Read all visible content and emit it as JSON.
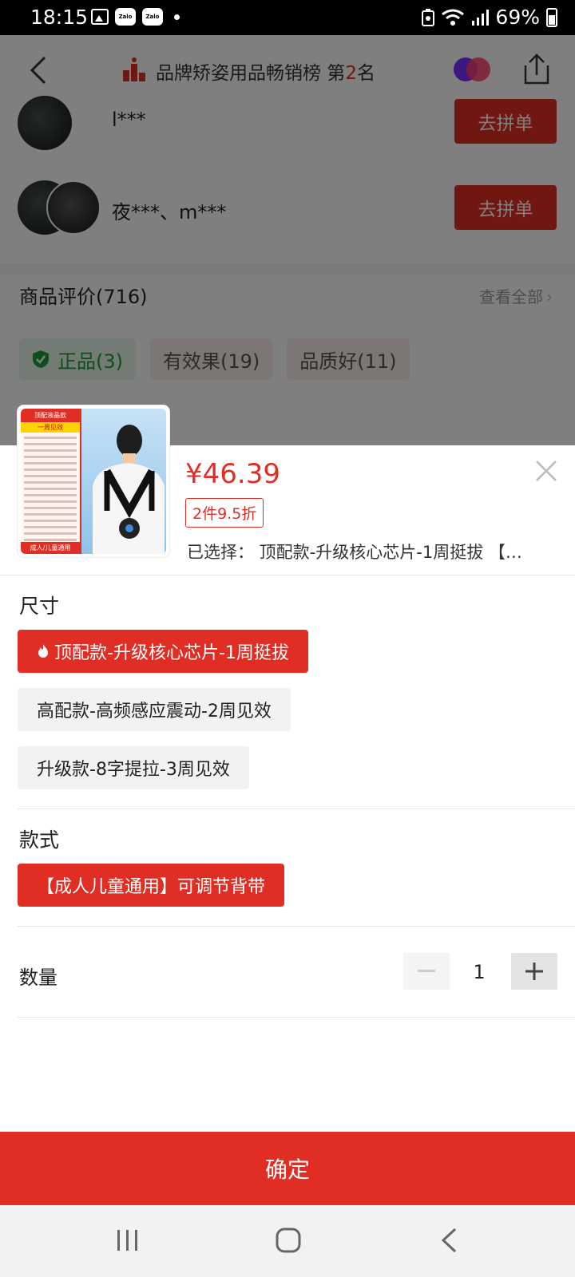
{
  "status_bar": {
    "time": "18:15",
    "notification_icons": [
      "image-icon",
      "zalo-icon",
      "zalo-icon"
    ],
    "zalo_label": "Zalo",
    "battery": "69%"
  },
  "header": {
    "title": "品牌矫姿用品畅销榜 第",
    "rank": "2",
    "rank_suffix": "名"
  },
  "group_buy": [
    {
      "name": "l***",
      "button": "去拼单"
    },
    {
      "name": "夜***、m***",
      "button": "去拼单"
    }
  ],
  "reviews": {
    "title": "商品评价(716)",
    "view_all": "查看全部",
    "tags": [
      "正品(3)",
      "有效果(19)",
      "品质好(11)"
    ]
  },
  "product_image": {
    "head": "顶配液晶款",
    "sub": "一周见效",
    "foot": "成人/儿童通用"
  },
  "sheet": {
    "price": "¥46.39",
    "discount": "2件9.5折",
    "selected": "已选择： 顶配款-升级核心芯片-1周挺拔 【…"
  },
  "size_section": {
    "label": "尺寸",
    "options": [
      {
        "label": "顶配款-升级核心芯片-1周挺拔",
        "selected": true,
        "hot": true
      },
      {
        "label": "高配款-高频感应震动-2周见效",
        "selected": false
      },
      {
        "label": "升级款-8字提拉-3周见效",
        "selected": false
      }
    ]
  },
  "style_section": {
    "label": "款式",
    "options": [
      {
        "label": "【成人儿童通用】可调节背带",
        "selected": true
      }
    ]
  },
  "quantity": {
    "label": "数量",
    "value": "1"
  },
  "confirm_button": "确定",
  "colors": {
    "accent": "#e02e24",
    "genuine_green": "#1d9b3a"
  }
}
